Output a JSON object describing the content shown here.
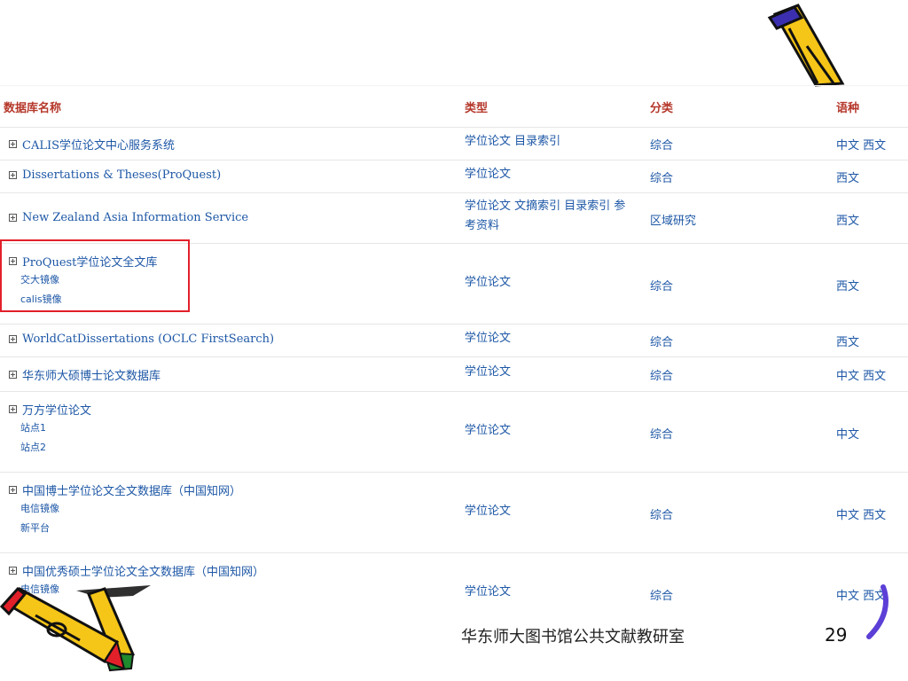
{
  "table": {
    "headers": {
      "name": "数据库名称",
      "type": "类型",
      "category": "分类",
      "language": "语种"
    },
    "rows": [
      {
        "name": "CALIS学位论文中心服务系统",
        "type": "学位论文 目录索引",
        "category": "综合",
        "language": "中文 西文",
        "subs": []
      },
      {
        "name": "Dissertations & Theses(ProQuest)",
        "type": "学位论文",
        "category": "综合",
        "language": "西文",
        "subs": []
      },
      {
        "name": "New Zealand Asia Information Service",
        "type": "学位论文 文摘索引 目录索引 参考资料",
        "category": "区域研究",
        "language": "西文",
        "subs": []
      },
      {
        "name": "ProQuest学位论文全文库",
        "type": "学位论文",
        "category": "综合",
        "language": "西文",
        "subs": [
          "交大镜像",
          "calis镜像"
        ]
      },
      {
        "name": "WorldCatDissertations (OCLC FirstSearch)",
        "type": "学位论文",
        "category": "综合",
        "language": "西文",
        "subs": []
      },
      {
        "name": "华东师大硕博士论文数据库",
        "type": "学位论文",
        "category": "综合",
        "language": "中文 西文",
        "subs": []
      },
      {
        "name": "万方学位论文",
        "type": "学位论文",
        "category": "综合",
        "language": "中文",
        "subs": [
          "站点1",
          "站点2"
        ]
      },
      {
        "name": "中国博士学位论文全文数据库（中国知网）",
        "type": "学位论文",
        "category": "综合",
        "language": "中文 西文",
        "subs": [
          "电信镜像",
          "新平台"
        ]
      },
      {
        "name": "中国优秀硕士学位论文全文数据库（中国知网）",
        "type": "学位论文",
        "category": "综合",
        "language": "中文 西文",
        "subs": [
          "电信镜像"
        ]
      }
    ]
  },
  "footer": {
    "text": "华东师大图书馆公共文献教研室",
    "page": "29"
  },
  "colors": {
    "header_text": "#b5372a",
    "link": "#1d57a6",
    "highlight_border": "#e2202a"
  },
  "icons": [
    "pencil-icon",
    "expand-plus-icon"
  ]
}
